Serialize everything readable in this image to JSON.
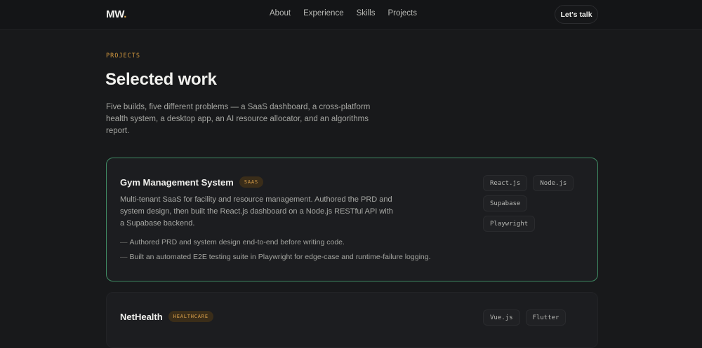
{
  "header": {
    "logo_text": "MW",
    "logo_dot": ".",
    "nav": [
      {
        "label": "About"
      },
      {
        "label": "Experience"
      },
      {
        "label": "Skills"
      },
      {
        "label": "Projects"
      }
    ],
    "cta_label": "Let's talk"
  },
  "section": {
    "eyebrow": "PROJECTS",
    "title": "Selected work",
    "intro": "Five builds, five different problems — a SaaS dashboard, a cross-platform health system, a desktop app, an AI resource allocator, and an algorithms report."
  },
  "projects": [
    {
      "title": "Gym Management System",
      "badge": "SAAS",
      "description": "Multi-tenant SaaS for facility and resource management. Authored the PRD and system design, then built the React.js dashboard on a Node.js RESTful API with a Supabase backend.",
      "bullets": [
        "Authored PRD and system design end-to-end before writing code.",
        "Built an automated E2E testing suite in Playwright for edge-case and runtime-failure logging."
      ],
      "tags": [
        "React.js",
        "Node.js",
        "Supabase",
        "Playwright"
      ]
    },
    {
      "title": "NetHealth",
      "badge": "HEALTHCARE",
      "tags": [
        "Vue.js",
        "Flutter"
      ]
    }
  ],
  "colors": {
    "background": "#18191b",
    "accent": "#e0a84a",
    "card_border_active": "#3f8a63"
  }
}
